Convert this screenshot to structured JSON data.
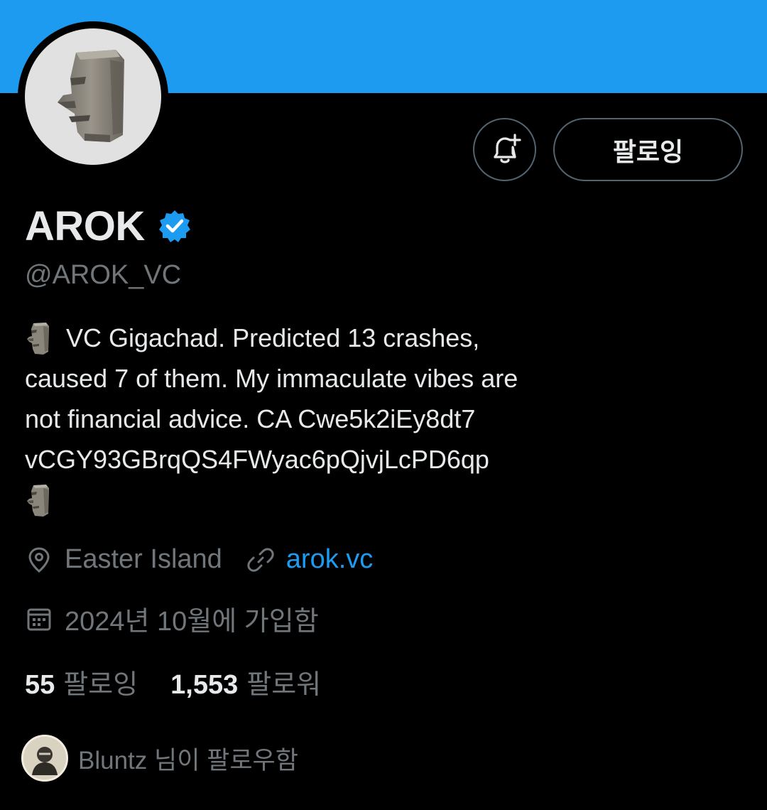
{
  "profile": {
    "display_name": "AROK",
    "handle": "@AROK_VC",
    "verified_color": "#1d9bf0",
    "banner_color": "#1d9bf0",
    "bio_lines": [
      "VC Gigachad. Predicted 13 crashes,",
      "caused 7 of them. My immaculate vibes are",
      "not financial advice.  CA Cwe5k2iEy8dt7",
      "vCGY93GBrqQS4FWyac6pQjvjLcPD6qp"
    ],
    "location": "Easter Island",
    "website": "arok.vc",
    "joined": "2024년 10월에 가입함"
  },
  "actions": {
    "follow_label": "팔로잉",
    "bell_icon": "bell-plus-icon"
  },
  "stats": {
    "following_count": "55",
    "following_label": "팔로잉",
    "followers_count": "1,553",
    "followers_label": "팔로워"
  },
  "followed_by": {
    "text": "Bluntz 님이 팔로우함"
  }
}
